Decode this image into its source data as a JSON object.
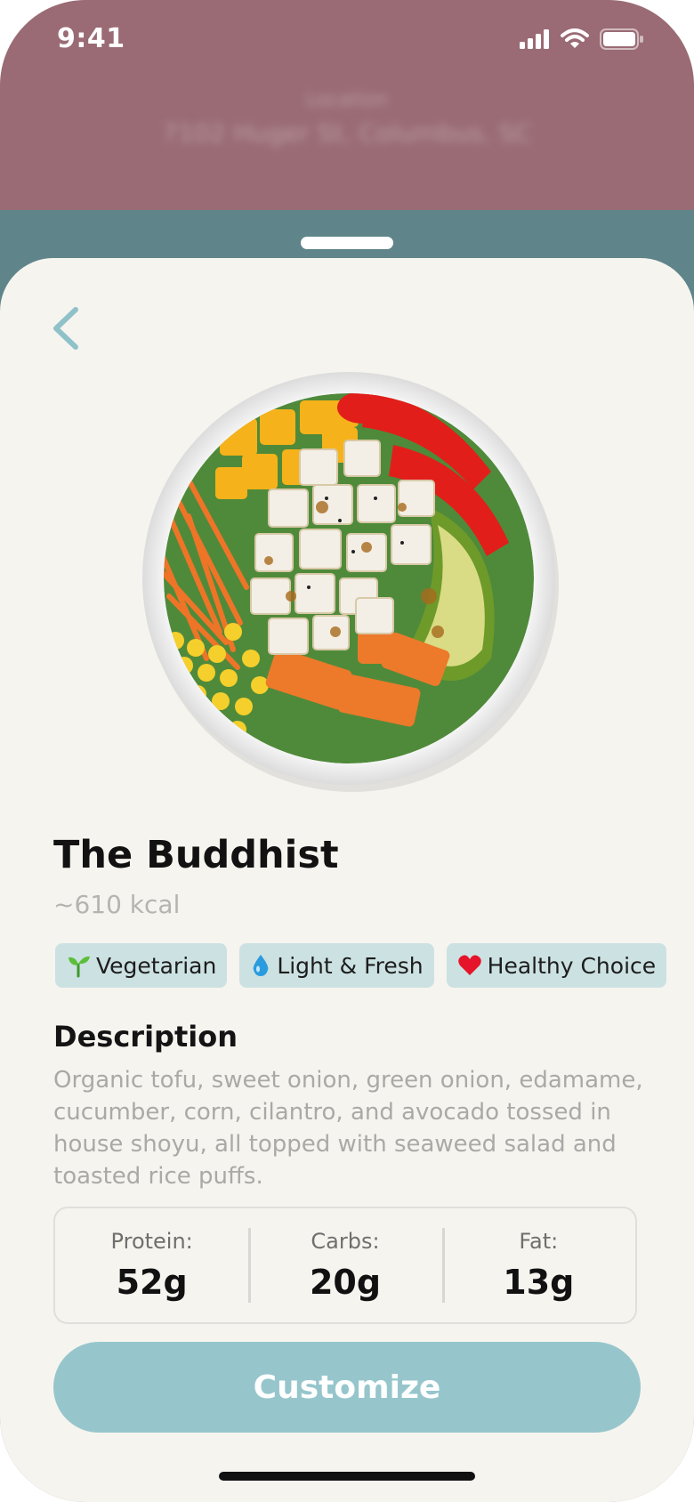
{
  "status_bar": {
    "time": "9:41"
  },
  "background_screen": {
    "location_label": "Location",
    "location_value": "7102 Huger St, Columbus, SC"
  },
  "dish": {
    "name": "The Buddhist",
    "calories": "~610 kcal",
    "tags": [
      {
        "icon": "seedling-icon",
        "label": "Vegetarian"
      },
      {
        "icon": "droplet-icon",
        "label": "Light & Fresh"
      },
      {
        "icon": "heart-icon",
        "label": "Healthy Choice"
      }
    ],
    "description_heading": "Description",
    "description": "Organic tofu, sweet onion, green onion, edamame, cucumber, corn, cilantro, and avocado tossed in house shoyu, all topped with seaweed salad and toasted rice puffs."
  },
  "macros": [
    {
      "label": "Protein:",
      "value": "52g"
    },
    {
      "label": "Carbs:",
      "value": "20g"
    },
    {
      "label": "Fat:",
      "value": "13g"
    }
  ],
  "actions": {
    "customize_label": "Customize"
  },
  "colors": {
    "header_background": "#9a6b74",
    "sheet_background": "#f6f4ef",
    "accent": "#96c6cc",
    "tag_background": "#cce1e2",
    "back_arrow": "#8fc1c8"
  }
}
